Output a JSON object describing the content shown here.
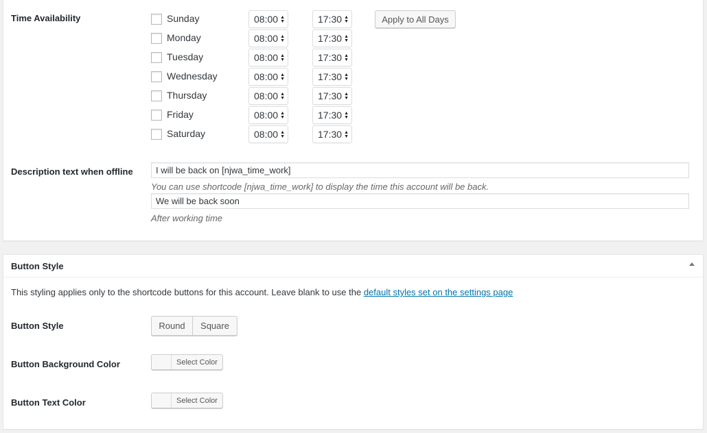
{
  "time_availability": {
    "label": "Time Availability",
    "apply_all_label": "Apply to All Days",
    "days": [
      {
        "name": "Sunday",
        "from": "08:00",
        "to": "17:30"
      },
      {
        "name": "Monday",
        "from": "08:00",
        "to": "17:30"
      },
      {
        "name": "Tuesday",
        "from": "08:00",
        "to": "17:30"
      },
      {
        "name": "Wednesday",
        "from": "08:00",
        "to": "17:30"
      },
      {
        "name": "Thursday",
        "from": "08:00",
        "to": "17:30"
      },
      {
        "name": "Friday",
        "from": "08:00",
        "to": "17:30"
      },
      {
        "name": "Saturday",
        "from": "08:00",
        "to": "17:30"
      }
    ]
  },
  "offline": {
    "label": "Description text when offline",
    "value": "I will be back on [njwa_time_work]",
    "hint": "You can use shortcode [njwa_time_work] to display the time this account will be back.",
    "after_value": "We will be back soon",
    "after_hint": "After working time"
  },
  "button_style_panel": {
    "title": "Button Style",
    "intro": "This styling applies only to the shortcode buttons for this account. Leave blank to use the ",
    "intro_link": "default styles set on the settings page",
    "style_label": "Button Style",
    "options": [
      "Round",
      "Square"
    ],
    "bg_color_label": "Button Background Color",
    "text_color_label": "Button Text Color",
    "select_color_label": "Select Color"
  },
  "colors": {
    "link": "#0073aa",
    "panel_bg": "#ffffff",
    "page_bg": "#f1f1f1"
  }
}
